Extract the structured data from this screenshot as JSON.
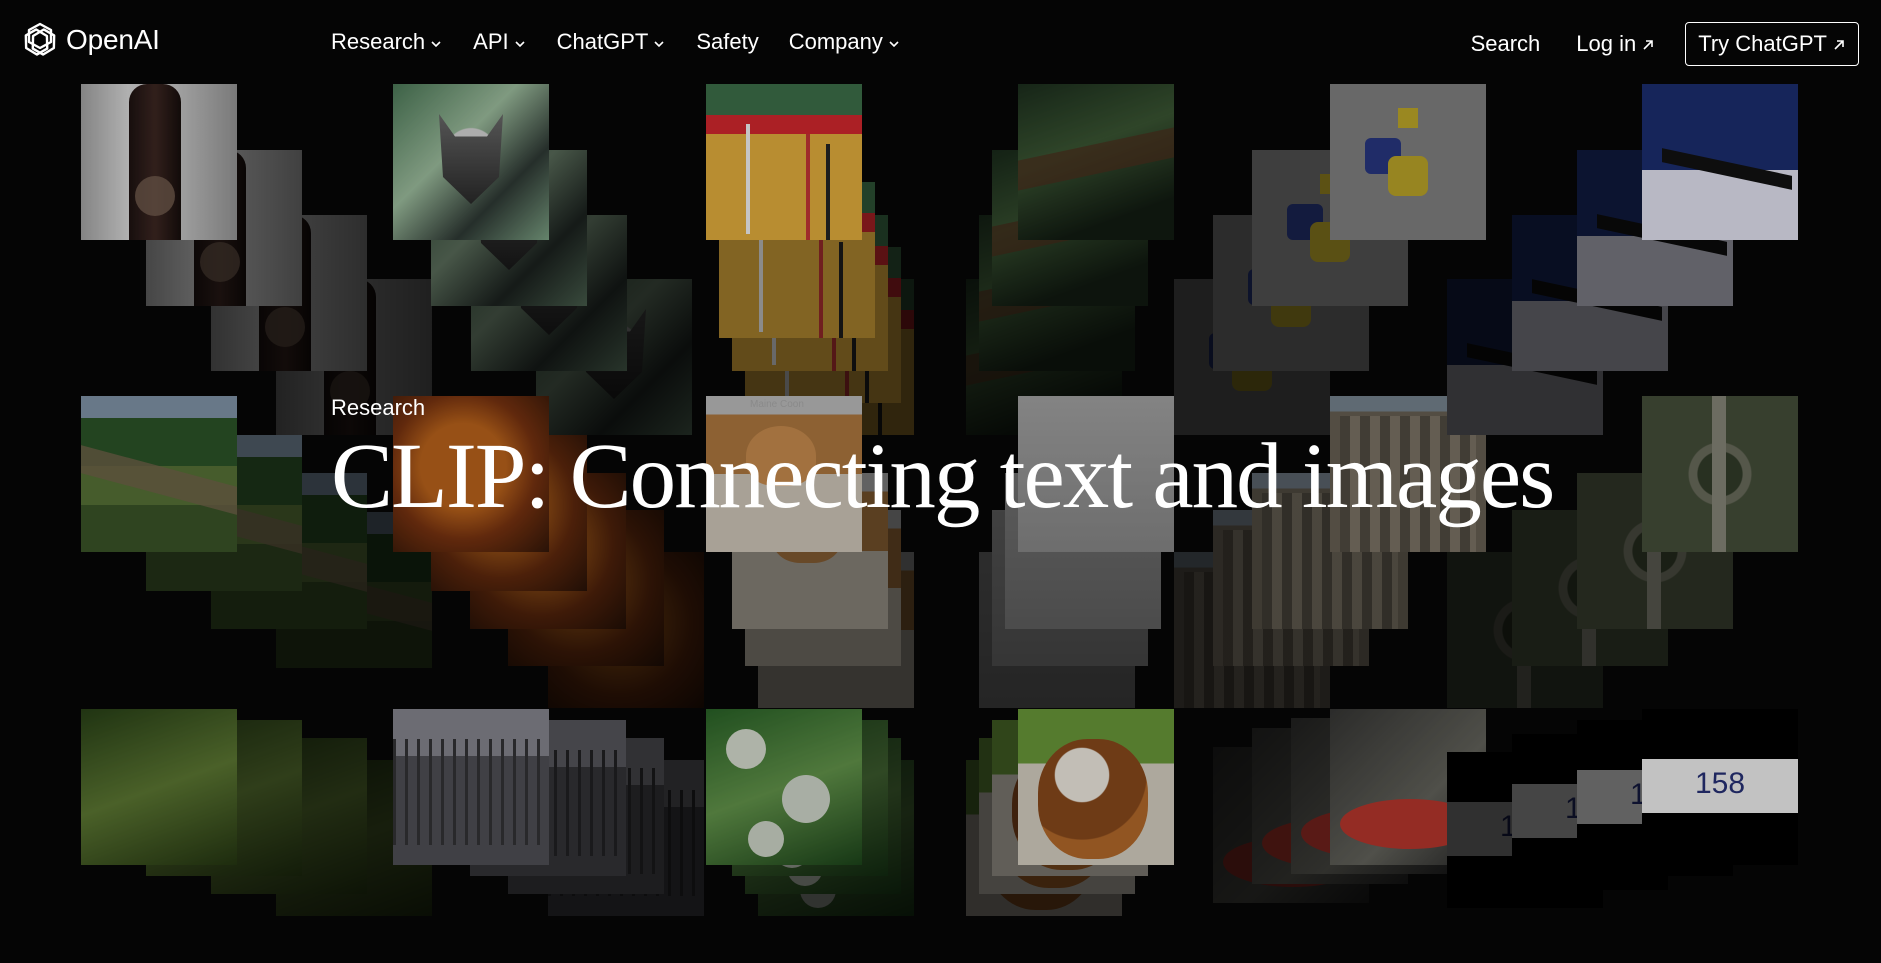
{
  "brand": {
    "name": "OpenAI"
  },
  "nav": {
    "items": [
      {
        "label": "Research",
        "dropdown": true
      },
      {
        "label": "API",
        "dropdown": true
      },
      {
        "label": "ChatGPT",
        "dropdown": true
      },
      {
        "label": "Safety",
        "dropdown": false
      },
      {
        "label": "Company",
        "dropdown": true
      }
    ]
  },
  "right_nav": {
    "search_label": "Search",
    "login_label": "Log in",
    "try_label": "Try ChatGPT"
  },
  "hero": {
    "kicker": "Research",
    "title": "CLIP: Connecting text and images"
  },
  "collage": {
    "cat_caption": "Maine Coon",
    "number_label": "158"
  },
  "colors": {
    "background": "#050505",
    "text": "#ffffff"
  },
  "icons": [
    "openai-logo-icon",
    "chevron-down-icon",
    "arrow-up-right-icon"
  ]
}
